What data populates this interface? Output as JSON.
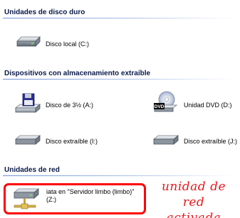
{
  "sections": {
    "hard_drives": {
      "title": "Unidades de disco duro",
      "items": [
        {
          "label": "Disco local (C:)",
          "icon": "hard-drive-icon"
        }
      ]
    },
    "removable": {
      "title": "Dispositivos con almacenamiento extraíble",
      "items": [
        {
          "label": "Disco de 3½ (A:)",
          "icon": "floppy-drive-icon"
        },
        {
          "label": "Unidad DVD (D:)",
          "icon": "dvd-drive-icon"
        },
        {
          "label": "Disco extraíble (I:)",
          "icon": "removable-drive-icon"
        },
        {
          "label": "Disco extraíble (J:)",
          "icon": "removable-drive-icon"
        }
      ]
    },
    "network": {
      "title": "Unidades de red",
      "items": [
        {
          "label_line1": "iata en \"Servidor limbo (limbo)\"",
          "label_line2": "(Z:)",
          "icon": "network-drive-icon"
        }
      ]
    }
  },
  "annotation": {
    "line1": "unidad de red",
    "line2": "activada",
    "color": "#e8191d"
  },
  "colors": {
    "section_title": "#0b1a4a",
    "section_rule": "#6f8fd6",
    "highlight": "#ff0000"
  }
}
